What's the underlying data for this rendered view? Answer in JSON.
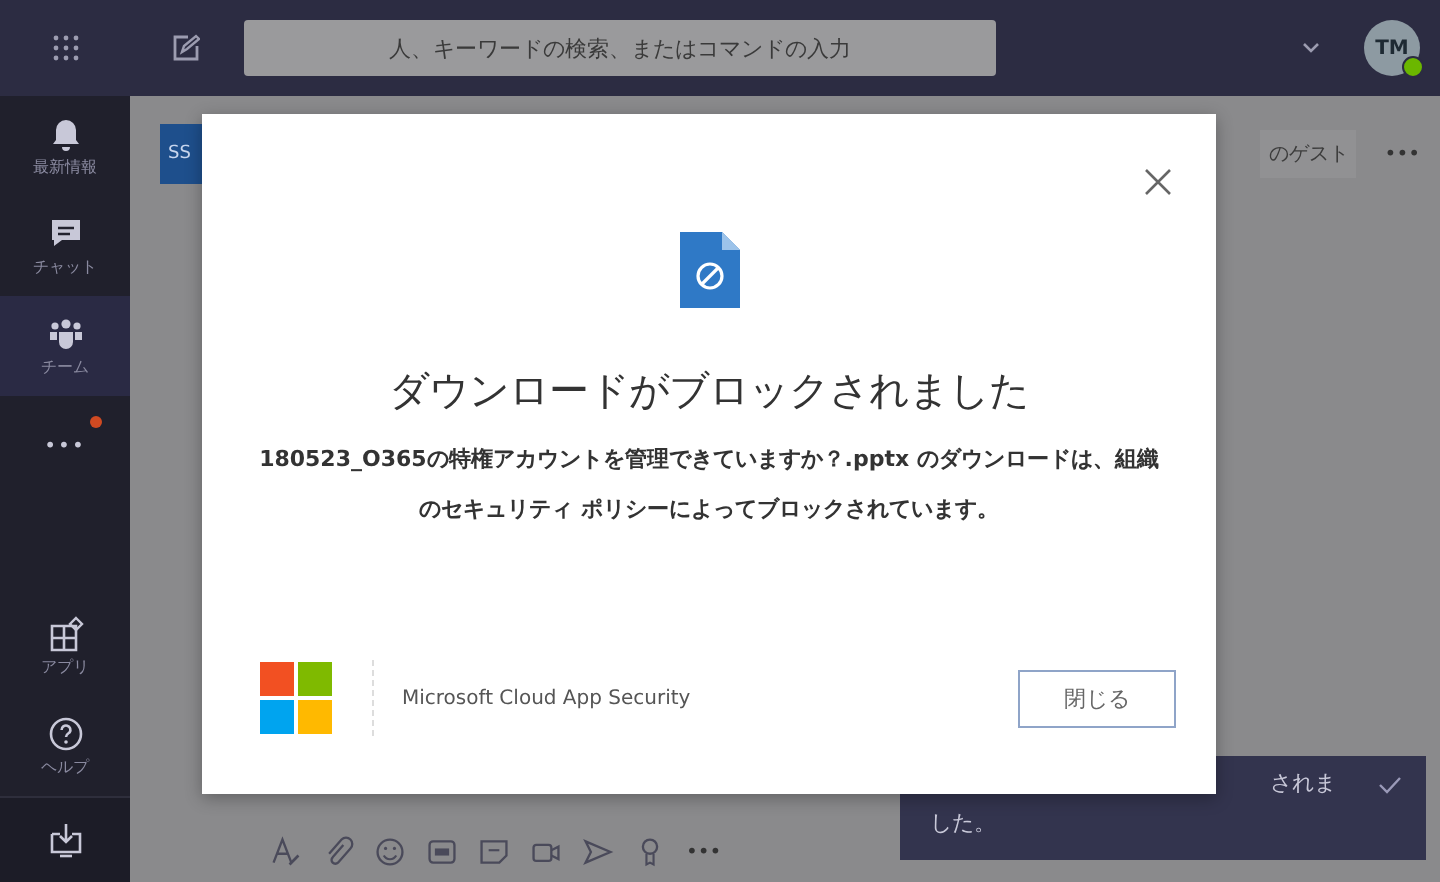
{
  "top_bar": {
    "search": {
      "placeholder": "人、キーワードの検索、またはコマンドの入力"
    },
    "avatar": {
      "initials": "TM",
      "online": true
    }
  },
  "sidebar": {
    "items": [
      {
        "kind": "bell",
        "label": "最新情報",
        "selected": false
      },
      {
        "kind": "chat",
        "label": "チャット",
        "selected": false
      },
      {
        "kind": "teams",
        "label": "チーム",
        "selected": true
      },
      {
        "kind": "more",
        "label": "•••",
        "selected": false,
        "notification": true
      },
      {
        "kind": "apps",
        "label": "アプリ",
        "selected": false
      },
      {
        "kind": "help",
        "label": "ヘルプ",
        "selected": false
      },
      {
        "kind": "download",
        "selected": false
      }
    ]
  },
  "background": {
    "tile": "SS",
    "header_tab": "のゲスト",
    "more": "•••"
  },
  "dialog": {
    "title": "ダウンロードがブロックされました",
    "message": "180523_O365の特権アカウントを管理できていますか？.pptx のダウンロードは、組織のセキュリティ ポリシーによってブロックされています。",
    "vendor": "Microsoft Cloud App Security",
    "close_button": "閉じる"
  },
  "toast": {
    "lines": [
      "されま",
      "した。"
    ]
  },
  "composer": {
    "more": "•••"
  }
}
